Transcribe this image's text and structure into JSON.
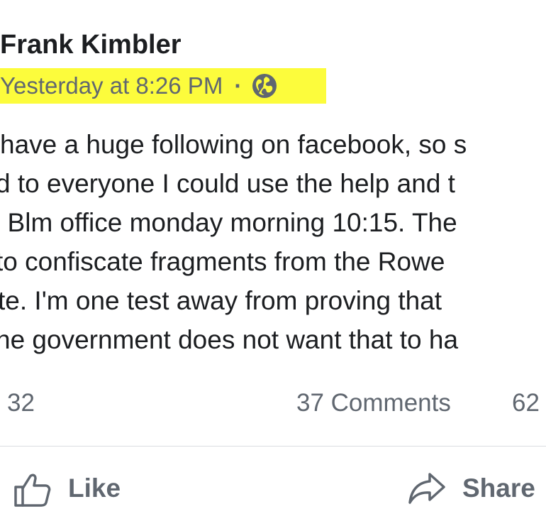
{
  "post": {
    "author": "Frank Kimbler",
    "timestamp": "Yesterday at 8:26 PM",
    "separator": "·",
    "privacy_icon": "globe-icon",
    "highlight_color": "#fcfc3c",
    "body_lines": [
      "have a huge following on facebook, so s",
      "d to everyone I could use the help and t",
      ". Blm office monday morning 10:15. The",
      " to confiscate fragments from the Rowe",
      "te. I'm one test away from proving that",
      "he government does not want that to ha"
    ]
  },
  "stats": {
    "reactions": "32",
    "comments": "37 Comments",
    "shares": "62"
  },
  "actions": {
    "like_label": "Like",
    "like_icon": "thumbs-up-icon",
    "share_label": "Share",
    "share_icon": "share-arrow-icon"
  },
  "colors": {
    "text": "#1c1e21",
    "secondary_text": "#606770",
    "divider": "#dadde1"
  }
}
